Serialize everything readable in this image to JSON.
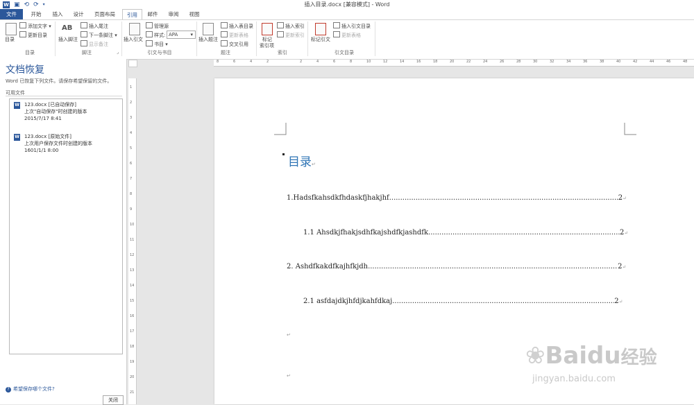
{
  "window": {
    "title": "插入目录.docx [兼容模式] - Word"
  },
  "qat": {
    "undo": "⟲",
    "redo": "⟳"
  },
  "tabs": [
    {
      "label": "文件"
    },
    {
      "label": "开始"
    },
    {
      "label": "插入"
    },
    {
      "label": "设计"
    },
    {
      "label": "页面布局"
    },
    {
      "label": "引用"
    },
    {
      "label": "邮件"
    },
    {
      "label": "审阅"
    },
    {
      "label": "视图"
    }
  ],
  "ribbon": {
    "toc": {
      "button": "目录",
      "add_text": "添加文字",
      "update": "更新目录",
      "group": "目录"
    },
    "footnotes": {
      "insert_footnote": "插入脚注",
      "ab": "AB",
      "insert_endnote": "插入尾注",
      "next_footnote": "下一条脚注",
      "show_notes": "显示备注",
      "group": "脚注"
    },
    "citations": {
      "insert_citation": "插入引文",
      "manage_sources": "管理源",
      "style_label": "样式:",
      "style_value": "APA",
      "bibliography": "书目",
      "group": "引文与书目"
    },
    "captions": {
      "insert_caption": "插入题注",
      "insert_table_of_figures": "插入表目录",
      "update_table": "更新表格",
      "cross_reference": "交叉引用",
      "group": "题注"
    },
    "index": {
      "mark_entry_1": "标记",
      "mark_entry_2": "索引项",
      "insert_index": "插入索引",
      "update_index": "更新索引",
      "group": "索引"
    },
    "toa": {
      "mark_citation": "标记引文",
      "insert_toa": "插入引文目录",
      "update_table": "更新表格",
      "group": "引文目录"
    }
  },
  "recovery": {
    "title": "文档恢复",
    "description": "Word 已恢复下列文件。请保存希望保留的文件。",
    "available_label": "可用文件",
    "files": [
      {
        "name": "123.docx  [已自动保存]",
        "desc": "上次\"自动保存\"时创建的版本",
        "date": "2015/7/17 8:41"
      },
      {
        "name": "123.docx  [原始文件]",
        "desc": "上次用户保存文件时创建的版本",
        "date": "1601/1/1 8:00"
      }
    ],
    "help": "希望保存哪个文件?",
    "close": "关闭"
  },
  "ruler": {
    "h_ticks": [
      "8",
      "6",
      "4",
      "2",
      "",
      "2",
      "4",
      "6",
      "8",
      "10",
      "12",
      "14",
      "16",
      "18",
      "20",
      "22",
      "24",
      "26",
      "28",
      "30",
      "32",
      "34",
      "36",
      "38",
      "40",
      "42",
      "44",
      "46",
      "48"
    ],
    "v_ticks": [
      "1",
      "2",
      "3",
      "4",
      "5",
      "6",
      "7",
      "8",
      "9",
      "10",
      "11",
      "12",
      "13",
      "14",
      "15",
      "16",
      "17",
      "18",
      "19",
      "20",
      "21"
    ]
  },
  "document": {
    "heading": "目录",
    "toc_entries": [
      {
        "text": "1.Hadsfkahsdkfhdaskfjhakjhf",
        "page": "2"
      },
      {
        "text": "1.1 Ahsdkjfhakjsdhfkajshdfkjashdfk",
        "page": "2"
      },
      {
        "text": "2. Ashdfkakdfkajhfkjdh",
        "page": "2"
      },
      {
        "text": "2.1 asfdajdkjhfdjkahfdkaj",
        "page": "2"
      }
    ],
    "para_mark": "↵"
  },
  "watermark": {
    "logo": "Baidu",
    "cn": "经验",
    "url": "jingyan.baidu.com"
  }
}
